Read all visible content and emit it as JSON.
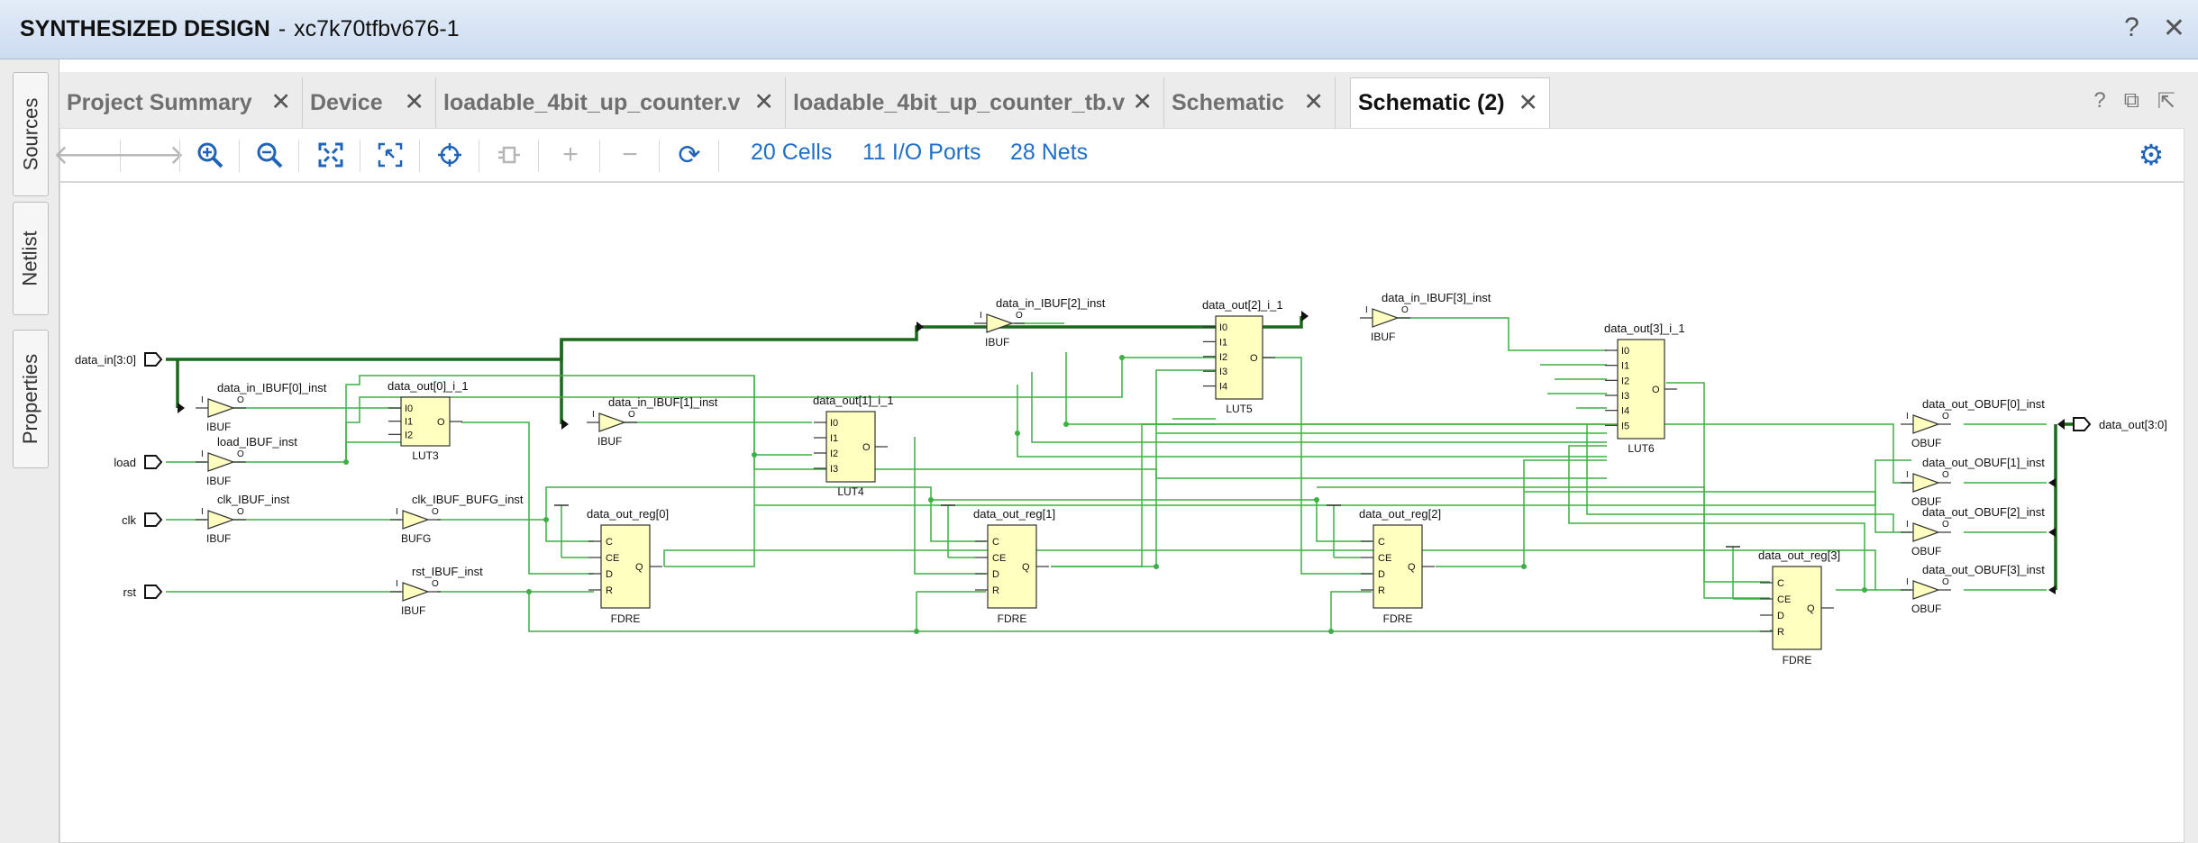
{
  "title": {
    "main": "SYNTHESIZED DESIGN",
    "separator": "-",
    "part": "xc7k70tfbv676-1"
  },
  "window_icons": {
    "help": "?",
    "close": "✕"
  },
  "side_tabs": [
    "Sources",
    "Netlist",
    "Properties"
  ],
  "tabs": [
    {
      "label": "Project Summary",
      "active": false
    },
    {
      "label": "Device",
      "active": false
    },
    {
      "label": "loadable_4bit_up_counter.v",
      "active": false
    },
    {
      "label": "loadable_4bit_up_counter_tb.v",
      "active": false
    },
    {
      "label": "Schematic",
      "active": false
    },
    {
      "label": "Schematic (2)",
      "active": true
    }
  ],
  "tab_controls": {
    "help": "?",
    "restore": "⧉",
    "float": "⇱"
  },
  "toolbar": {
    "icons": [
      "back-icon",
      "forward-icon",
      "zoom-in-icon",
      "zoom-out-icon",
      "fit-icon",
      "zoom-area-icon",
      "crosshair-icon",
      "expand-cell-icon",
      "plus-icon",
      "minus-icon",
      "refresh-icon",
      "gear-icon"
    ],
    "cells": "20 Cells",
    "io_ports": "11 I/O Ports",
    "nets": "28 Nets"
  },
  "schematic": {
    "ports": {
      "data_in": "data_in[3:0]",
      "load": "load",
      "clk": "clk",
      "rst": "rst",
      "data_out": "data_out[3:0]"
    },
    "ibufs": [
      {
        "name": "data_in_IBUF[0]_inst",
        "type": "IBUF"
      },
      {
        "name": "load_IBUF_inst",
        "type": "IBUF"
      },
      {
        "name": "clk_IBUF_inst",
        "type": "IBUF"
      },
      {
        "name": "rst_IBUF_inst",
        "type": "IBUF"
      },
      {
        "name": "data_in_IBUF[1]_inst",
        "type": "IBUF"
      },
      {
        "name": "data_in_IBUF[2]_inst",
        "type": "IBUF"
      },
      {
        "name": "data_in_IBUF[3]_inst",
        "type": "IBUF"
      }
    ],
    "bufg": {
      "name": "clk_IBUF_BUFG_inst",
      "type": "BUFG"
    },
    "luts": [
      {
        "name": "data_out[0]_i_1",
        "type": "LUT3",
        "pins": [
          "I0",
          "I1",
          "I2"
        ]
      },
      {
        "name": "data_out[1]_i_1",
        "type": "LUT4",
        "pins": [
          "I0",
          "I1",
          "I2",
          "I3"
        ]
      },
      {
        "name": "data_out[2]_i_1",
        "type": "LUT5",
        "pins": [
          "I0",
          "I1",
          "I2",
          "I3",
          "I4"
        ]
      },
      {
        "name": "data_out[3]_i_1",
        "type": "LUT6",
        "pins": [
          "I0",
          "I1",
          "I2",
          "I3",
          "I4",
          "I5"
        ]
      }
    ],
    "regs": [
      {
        "name": "data_out_reg[0]",
        "type": "FDRE"
      },
      {
        "name": "data_out_reg[1]",
        "type": "FDRE"
      },
      {
        "name": "data_out_reg[2]",
        "type": "FDRE"
      },
      {
        "name": "data_out_reg[3]",
        "type": "FDRE"
      }
    ],
    "reg_pins": [
      "C",
      "CE",
      "D",
      "R"
    ],
    "reg_out": "Q",
    "obufs": [
      {
        "name": "data_out_OBUF[0]_inst",
        "type": "OBUF"
      },
      {
        "name": "data_out_OBUF[1]_inst",
        "type": "OBUF"
      },
      {
        "name": "data_out_OBUF[2]_inst",
        "type": "OBUF"
      },
      {
        "name": "data_out_OBUF[3]_inst",
        "type": "OBUF"
      }
    ],
    "pin_in": "I",
    "pin_out": "O"
  },
  "colors": {
    "wire": "#3cb043",
    "bus": "#1a6a1a",
    "cell_fill": "#ffffc0",
    "link": "#1f6fc8",
    "title_bg": "#d6e3f4"
  }
}
